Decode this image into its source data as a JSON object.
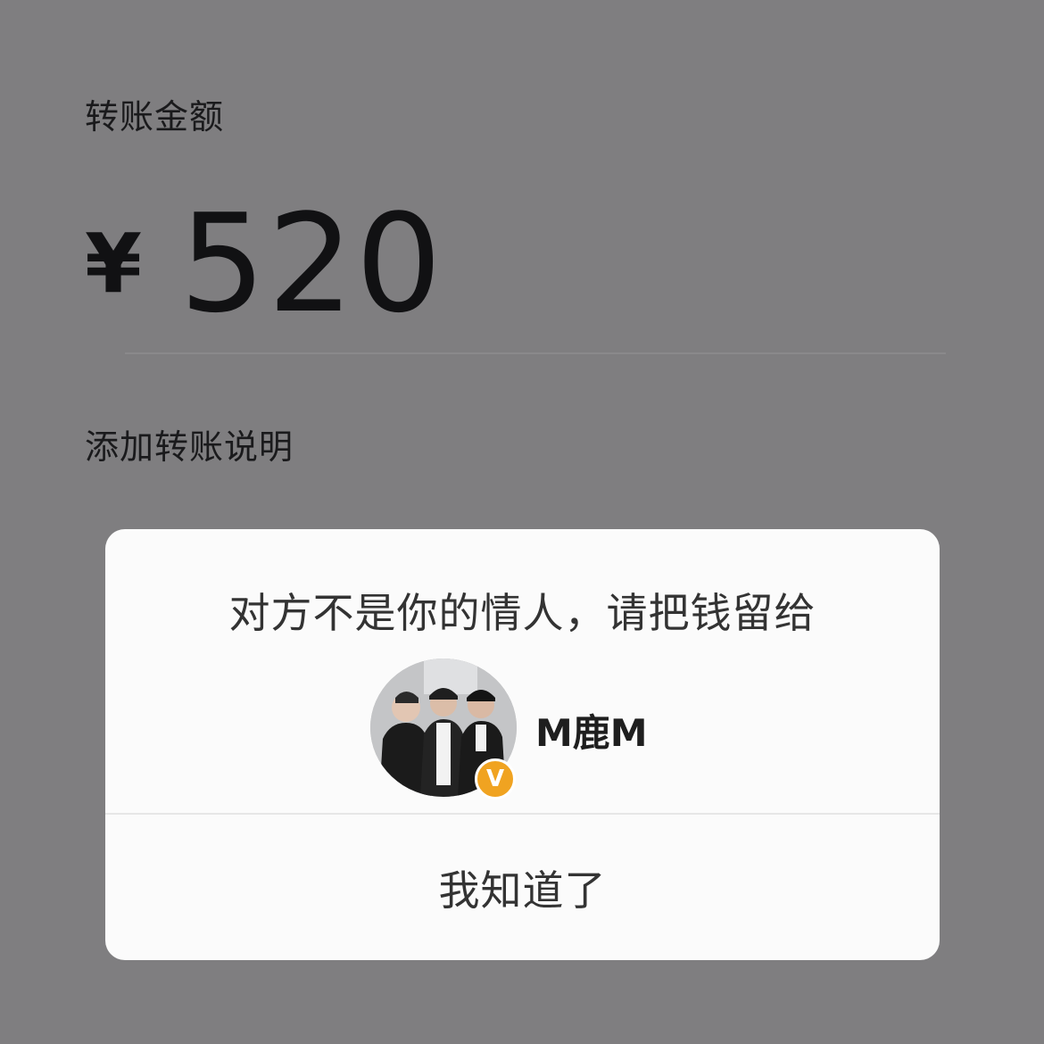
{
  "transfer": {
    "amount_label": "转账金额",
    "currency_symbol": "¥",
    "amount": "520",
    "add_note": "添加转账说明"
  },
  "dialog": {
    "message": "对方不是你的情人，请把钱留给",
    "username": "M鹿M",
    "verified_badge": "V",
    "confirm_label": "我知道了"
  }
}
